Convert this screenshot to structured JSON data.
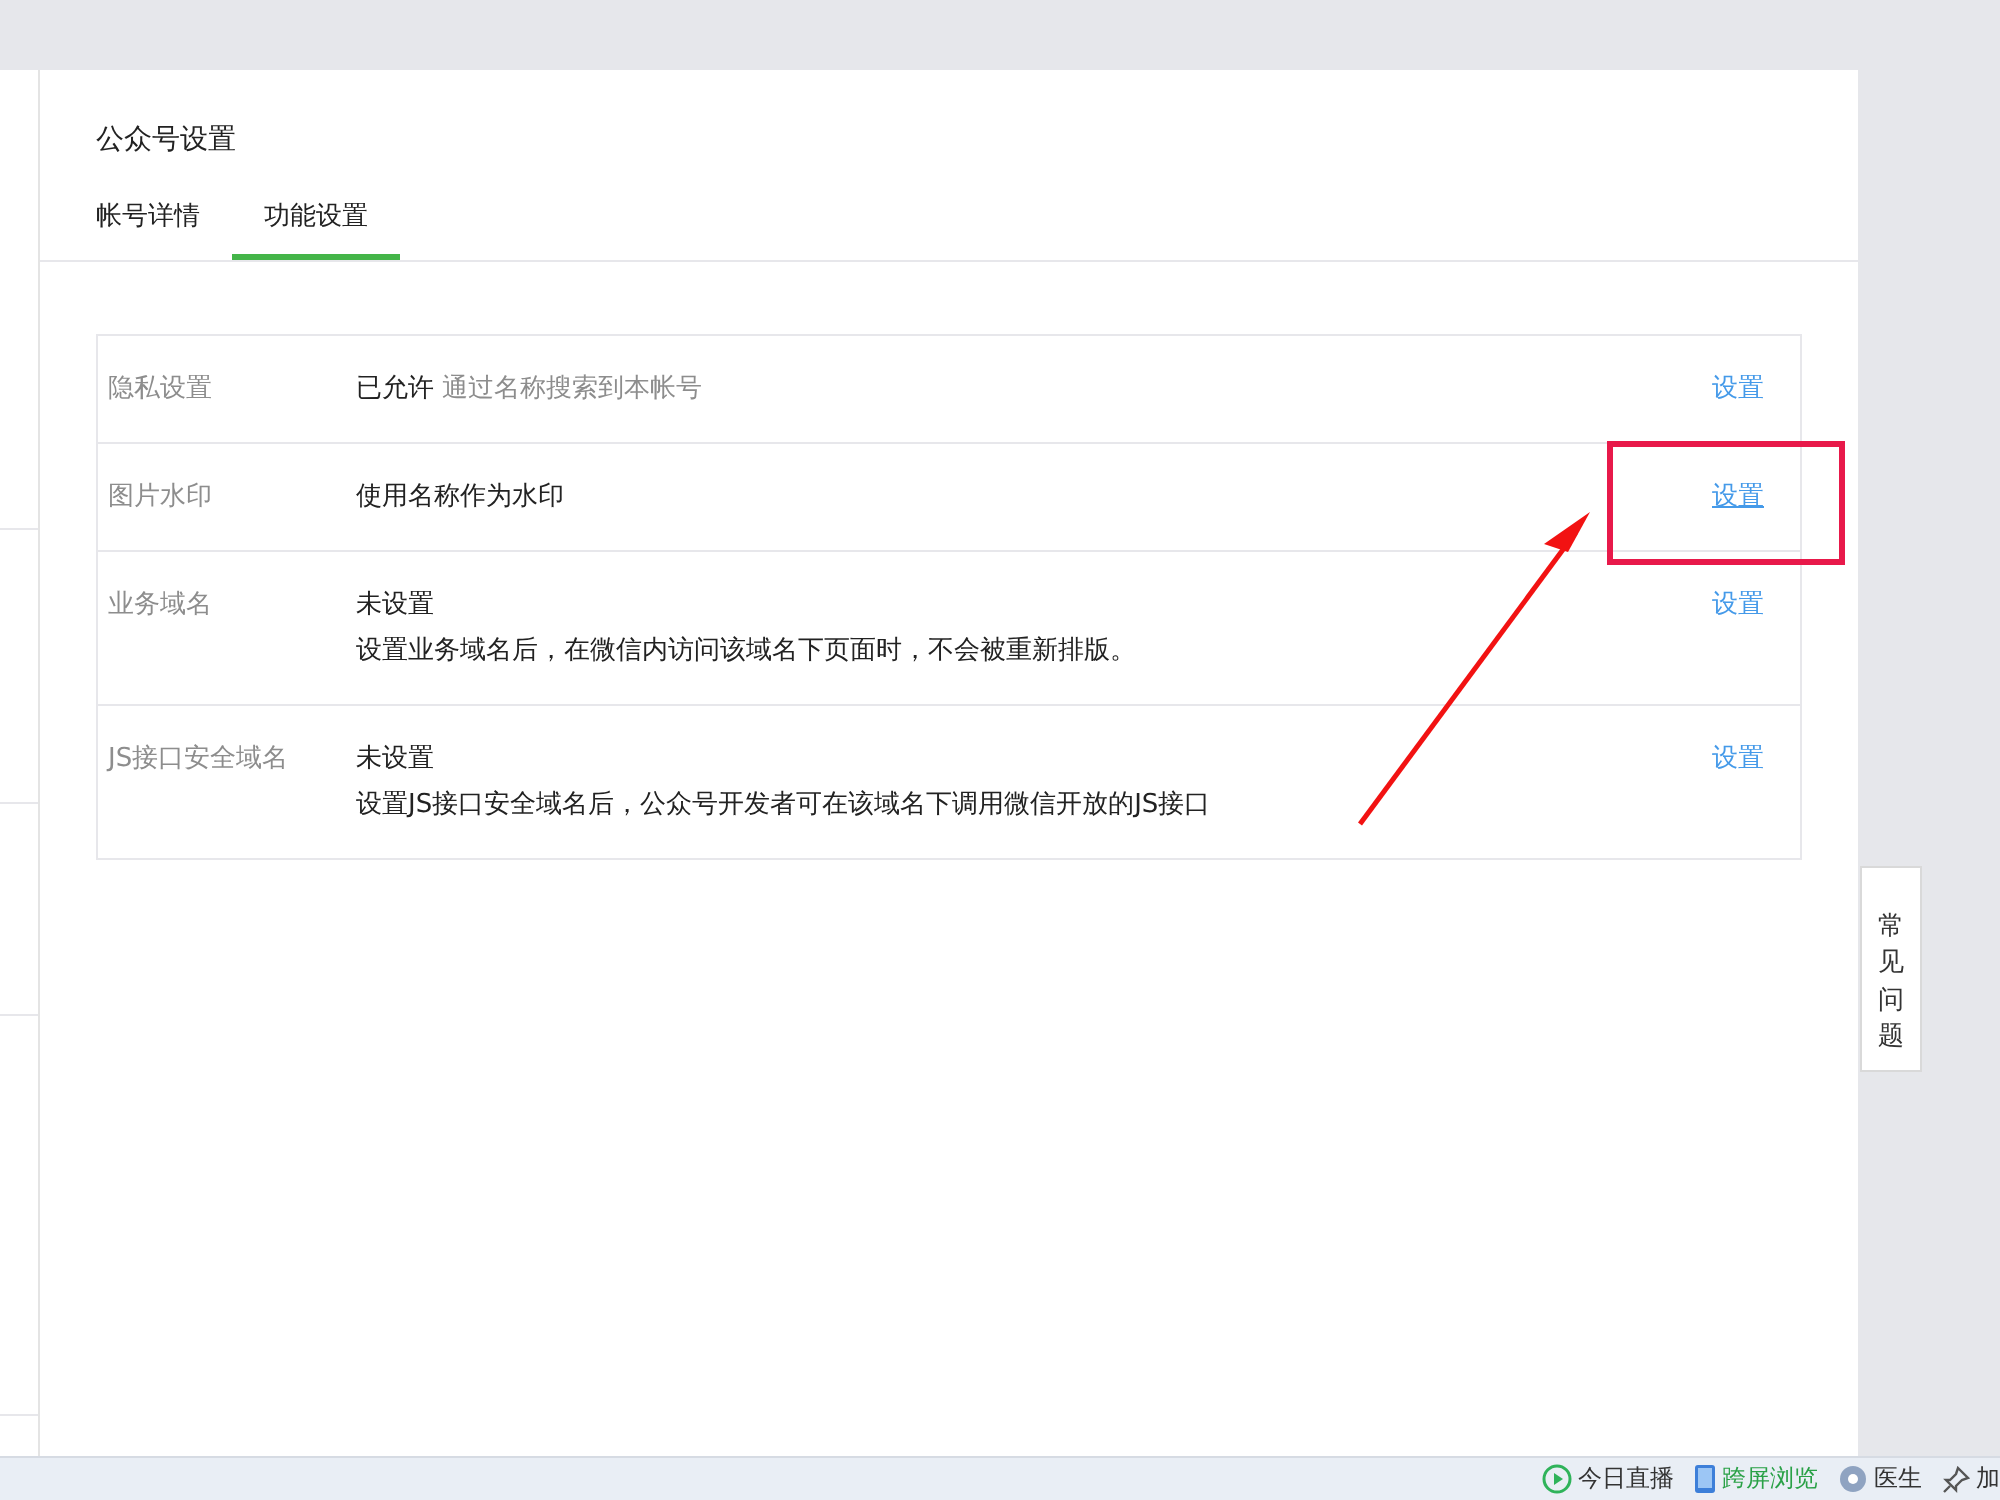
{
  "panel": {
    "title": "公众号设置",
    "tabs": [
      {
        "label": "帐号详情",
        "selected": false
      },
      {
        "label": "功能设置",
        "selected": true
      }
    ]
  },
  "settings": [
    {
      "label": "隐私设置",
      "value": "已允许",
      "note": "通过名称搜索到本帐号",
      "link": {
        "label": "设置",
        "underlined": false
      }
    },
    {
      "label": "图片水印",
      "value": "使用名称作为水印",
      "link": {
        "label": "设置",
        "underlined": true
      }
    },
    {
      "label": "业务域名",
      "value": "未设置",
      "description": "设置业务域名后，在微信内访问该域名下页面时，不会被重新排版。",
      "link": {
        "label": "设置",
        "underlined": false
      }
    },
    {
      "label": "JS接口安全域名",
      "value": "未设置",
      "description": "设置JS接口安全域名后，公众号开发者可在该域名下调用微信开放的JS接口",
      "link": {
        "label": "设置",
        "underlined": false
      }
    }
  ],
  "faq_tab": "常见问题",
  "status_bar": [
    {
      "kind": "play",
      "label": "今日直播",
      "highlighted": false
    },
    {
      "kind": "phone",
      "label": "跨屏浏览",
      "highlighted": true
    },
    {
      "kind": "doctor",
      "label": "医生",
      "highlighted": false
    },
    {
      "kind": "pin",
      "label": "加",
      "highlighted": false
    }
  ]
}
